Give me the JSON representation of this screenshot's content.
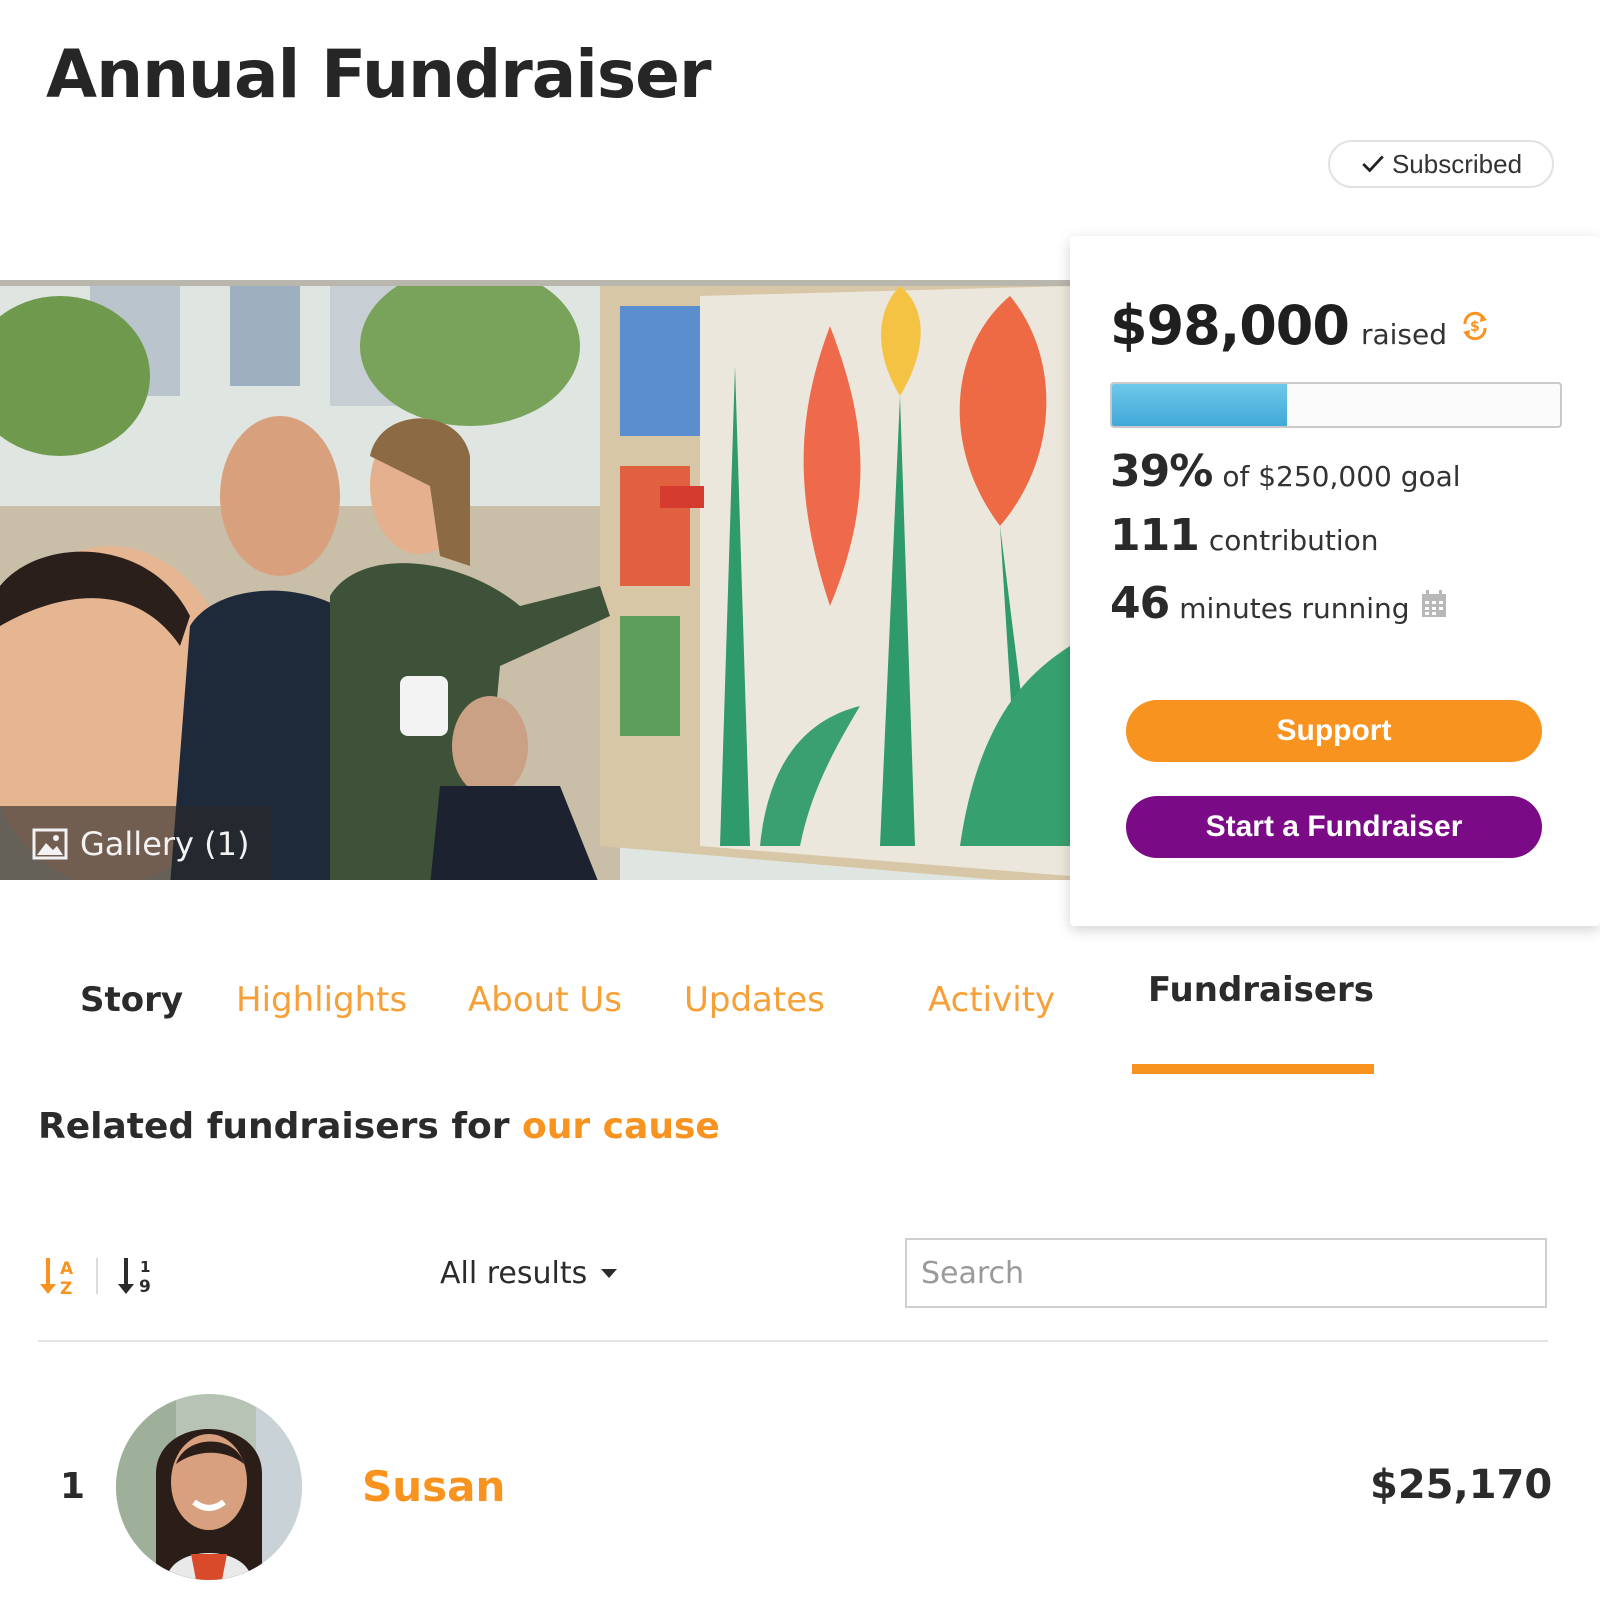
{
  "page": {
    "title": "Annual Fundraiser"
  },
  "subscribe": {
    "label": "Subscribed"
  },
  "gallery": {
    "label": "Gallery (1)"
  },
  "donation": {
    "raised_amount": "$98,000",
    "raised_label": "raised",
    "progress_percent": 39,
    "goal_percent": "39%",
    "goal_label": "of $250,000 goal",
    "contributions": "111",
    "contributions_label": "contribution",
    "minutes": "46",
    "minutes_label": "minutes running",
    "support_label": "Support",
    "start_label": "Start a Fundraiser",
    "accent_color": "#f7931e",
    "secondary_color": "#7b0a86",
    "progress_color": "#4ab0de"
  },
  "tabs": [
    {
      "label": "Story"
    },
    {
      "label": "Highlights"
    },
    {
      "label": "About Us"
    },
    {
      "label": "Updates"
    },
    {
      "label": "Activity"
    },
    {
      "label": "Fundraisers",
      "active": true
    }
  ],
  "related": {
    "prefix": "Related fundraisers for",
    "accent": "our cause"
  },
  "toolbar": {
    "filter_label": "All results",
    "search_placeholder": "Search"
  },
  "results": [
    {
      "rank": "1",
      "name": "Susan",
      "amount": "$25,170"
    }
  ]
}
